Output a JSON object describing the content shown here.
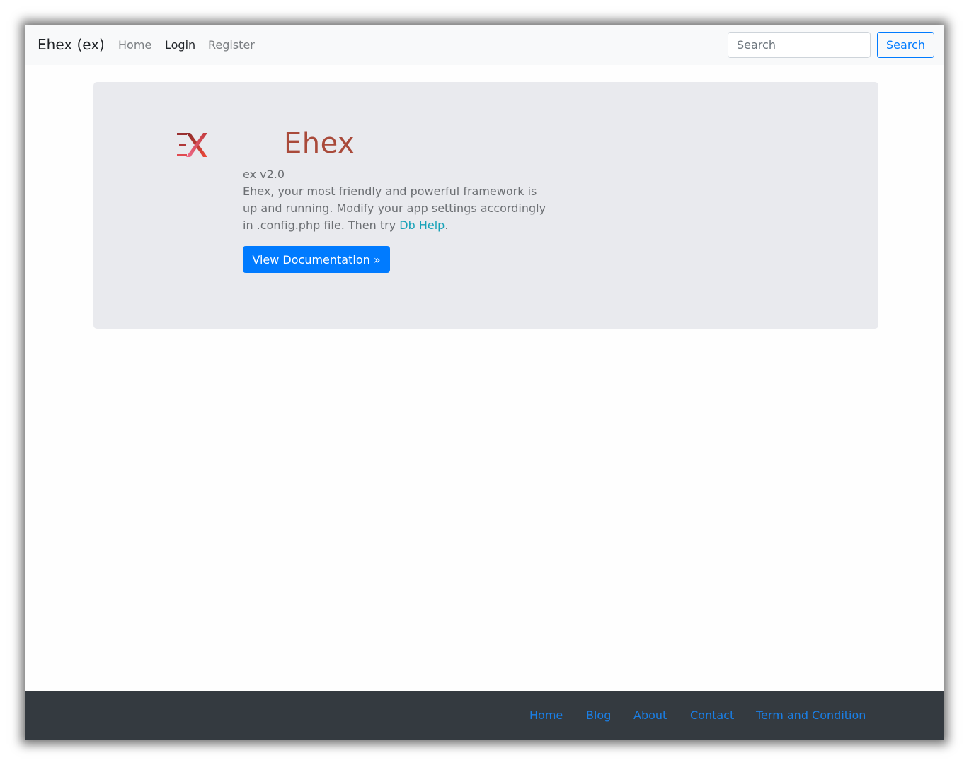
{
  "navbar": {
    "brand": "Ehex (ex)",
    "links": [
      {
        "label": "Home",
        "active": false
      },
      {
        "label": "Login",
        "active": true
      },
      {
        "label": "Register",
        "active": false
      }
    ],
    "search": {
      "placeholder": "Search",
      "value": "",
      "button_label": "Search"
    }
  },
  "hero": {
    "logo_icon": "ex-logo-icon",
    "title": "Ehex",
    "version": "ex v2.0",
    "description_before_link": "Ehex, your most friendly and powerful framework is up and running. Modify your app settings accordingly in .config.php file. Then try ",
    "link_text": "Db Help",
    "description_after_link": ".",
    "button_label": "View Documentation »"
  },
  "footer": {
    "links": [
      "Home",
      "Blog",
      "About",
      "Contact",
      "Term and Condition"
    ]
  },
  "colors": {
    "primary": "#007bff",
    "info_link": "#17a2b8",
    "hero_title": "#a94a3a",
    "jumbotron_bg": "#e9eaee",
    "footer_bg": "#343a40"
  }
}
